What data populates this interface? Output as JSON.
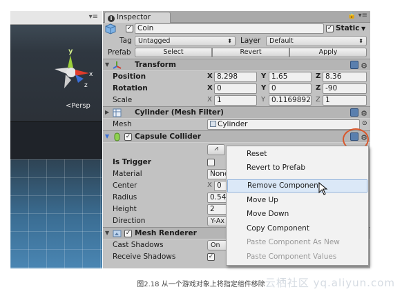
{
  "scene": {
    "persp_label": "<Persp",
    "gizmo_axes": {
      "y": "y",
      "x": "x",
      "z": "z"
    }
  },
  "inspector": {
    "tab_label": "Inspector",
    "tab_icon": "info-icon",
    "object_name": "Coin",
    "object_active": true,
    "static_label": "Static",
    "static_checked": true,
    "tag_label": "Tag",
    "tag_value": "Untagged",
    "layer_label": "Layer",
    "layer_value": "Default",
    "prefab_label": "Prefab",
    "prefab_buttons": [
      "Select",
      "Revert",
      "Apply"
    ]
  },
  "transform": {
    "title": "Transform",
    "rows": [
      {
        "label": "Position",
        "x": "8.298",
        "y": "1.65",
        "z": "8.36"
      },
      {
        "label": "Rotation",
        "x": "0",
        "y": "0",
        "z": "-90"
      },
      {
        "label": "Scale",
        "x": "1",
        "y": "0.1169892",
        "z": "1"
      }
    ]
  },
  "mesh_filter": {
    "title": "Cylinder (Mesh Filter)",
    "mesh_label": "Mesh",
    "mesh_value": "Cylinder"
  },
  "capsule_collider": {
    "title": "Capsule Collider",
    "enabled": true,
    "is_trigger_label": "Is Trigger",
    "material_label": "Material",
    "material_value": "None",
    "center_label": "Center",
    "center_x": "0",
    "radius_label": "Radius",
    "radius_value": "0.54",
    "height_label": "Height",
    "height_value": "2",
    "direction_label": "Direction",
    "direction_value": "Y-Ax"
  },
  "mesh_renderer": {
    "title": "Mesh Renderer",
    "enabled": true,
    "cast_shadows_label": "Cast Shadows",
    "cast_shadows_value": "On",
    "receive_shadows_label": "Receive Shadows",
    "receive_shadows_checked": true
  },
  "context_menu": {
    "items": [
      {
        "label": "Reset",
        "enabled": true
      },
      {
        "label": "Revert to Prefab",
        "enabled": true
      },
      {
        "label": "Remove Component",
        "enabled": true,
        "hovered": true
      },
      {
        "label": "Move Up",
        "enabled": true
      },
      {
        "label": "Move Down",
        "enabled": true
      },
      {
        "label": "Copy Component",
        "enabled": true
      },
      {
        "label": "Paste Component As New",
        "enabled": false
      },
      {
        "label": "Paste Component Values",
        "enabled": false
      }
    ]
  },
  "caption": "图2.18   从一个游戏对象上将指定组件移除",
  "watermark": "云栖社区 yq.aliyun.com",
  "colors": {
    "inspector_bg": "#c2c2c2",
    "menu_hover": "#dbe8f7",
    "highlight_circle": "#d9572b"
  }
}
